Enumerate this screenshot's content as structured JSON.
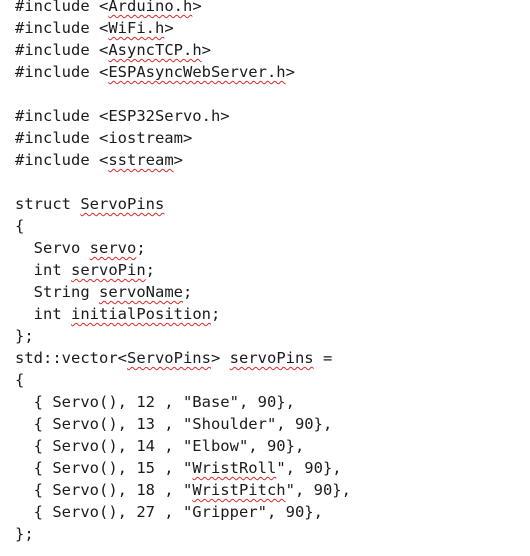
{
  "code": {
    "spellcheck_underline_color": "#d92b2b",
    "lines": [
      [
        {
          "t": "#include <"
        },
        {
          "t": "Arduino.h",
          "err": true
        },
        {
          "t": ">"
        }
      ],
      [
        {
          "t": "#include <"
        },
        {
          "t": "WiFi.h",
          "err": true
        },
        {
          "t": ">"
        }
      ],
      [
        {
          "t": "#include <"
        },
        {
          "t": "AsyncTCP.h",
          "err": true
        },
        {
          "t": ">"
        }
      ],
      [
        {
          "t": "#include <"
        },
        {
          "t": "ESPAsyncWebServer.h",
          "err": true
        },
        {
          "t": ">"
        }
      ],
      [],
      [
        {
          "t": "#include <ESP32Servo.h>"
        }
      ],
      [
        {
          "t": "#include <iostream>"
        }
      ],
      [
        {
          "t": "#include <"
        },
        {
          "t": "sstream",
          "err": true
        },
        {
          "t": ">"
        }
      ],
      [],
      [
        {
          "t": "struct "
        },
        {
          "t": "ServoPins",
          "err": true
        }
      ],
      [
        {
          "t": "{"
        }
      ],
      [
        {
          "t": "  Servo "
        },
        {
          "t": "servo",
          "err": true
        },
        {
          "t": ";"
        }
      ],
      [
        {
          "t": "  int "
        },
        {
          "t": "servoPin",
          "err": true
        },
        {
          "t": ";"
        }
      ],
      [
        {
          "t": "  String "
        },
        {
          "t": "servoName",
          "err": true
        },
        {
          "t": ";"
        }
      ],
      [
        {
          "t": "  int "
        },
        {
          "t": "initialPosition",
          "err": true
        },
        {
          "t": ";"
        }
      ],
      [
        {
          "t": "};"
        }
      ],
      [
        {
          "t": "std::vector<"
        },
        {
          "t": "ServoPins",
          "err": true
        },
        {
          "t": "> "
        },
        {
          "t": "servoPins",
          "err": true
        },
        {
          "t": " ="
        }
      ],
      [
        {
          "t": "{"
        }
      ],
      [
        {
          "t": "  { Servo(), 12 , \"Base\", 90},"
        }
      ],
      [
        {
          "t": "  { Servo(), 13 , \"Shoulder\", 90},"
        }
      ],
      [
        {
          "t": "  { Servo(), 14 , \"Elbow\", 90},"
        }
      ],
      [
        {
          "t": "  { Servo(), 15 , \""
        },
        {
          "t": "WristRoll",
          "err": true
        },
        {
          "t": "\", 90},"
        }
      ],
      [
        {
          "t": "  { Servo(), 18 , \""
        },
        {
          "t": "WristPitch",
          "err": true
        },
        {
          "t": "\", 90},"
        }
      ],
      [
        {
          "t": "  { Servo(), 27 , \"Gripper\", 90},"
        }
      ],
      [
        {
          "t": "};"
        }
      ]
    ]
  }
}
